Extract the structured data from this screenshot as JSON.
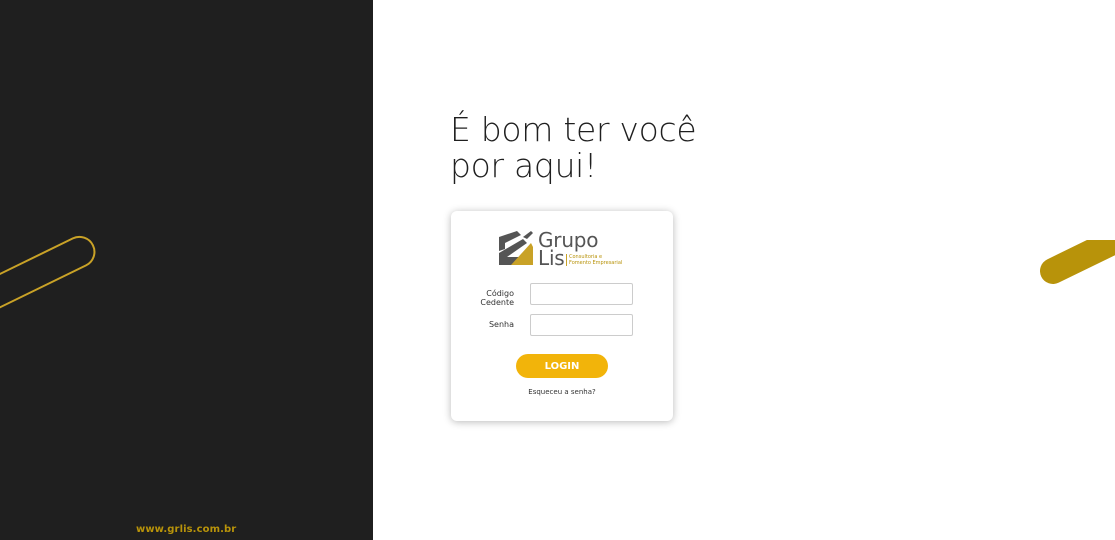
{
  "headline": {
    "line1": "É bom ter você",
    "line2": "por aqui!"
  },
  "logo": {
    "word1": "Grupo",
    "word2": "Lis",
    "tagline_line1": "Consultoria e",
    "tagline_line2": "Fomento Empresarial"
  },
  "form": {
    "codigo_label": "Código Cedente",
    "codigo_value": "",
    "senha_label": "Senha",
    "senha_value": "",
    "login_label": "LOGIN",
    "forgot_label": "Esqueceu a senha?"
  },
  "footer": {
    "url": "www.grlis.com.br"
  },
  "colors": {
    "dark_panel": "#1f1f1f",
    "accent_gold": "#b8930a",
    "button_yellow": "#f2b40a"
  }
}
